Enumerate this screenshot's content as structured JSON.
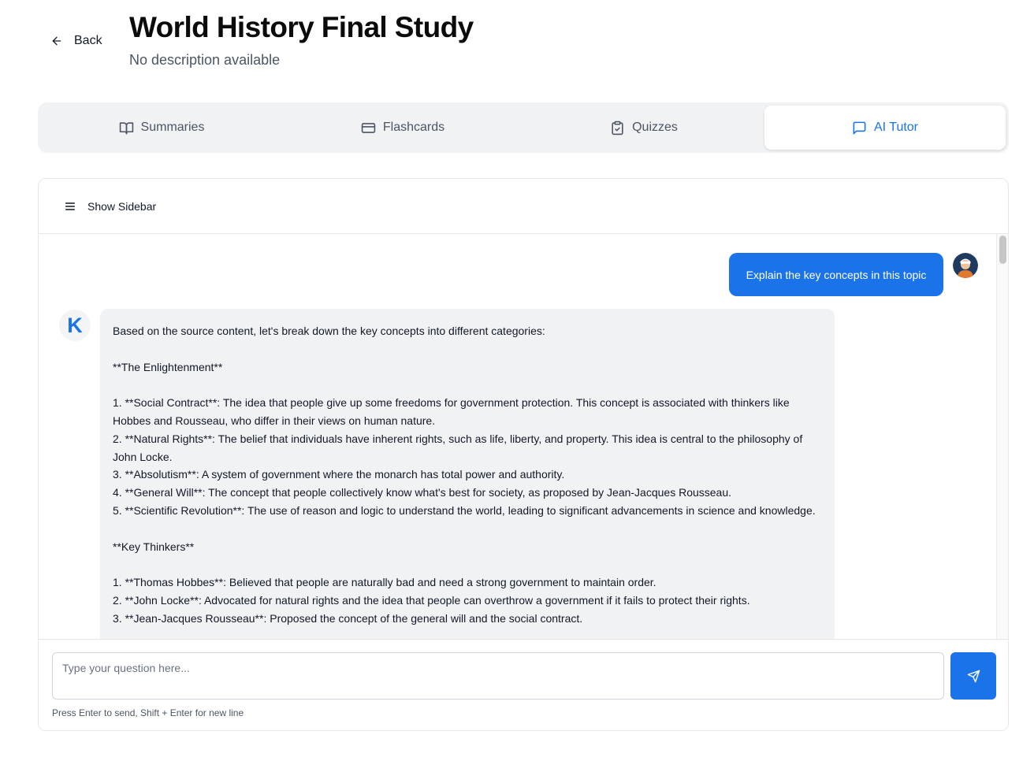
{
  "header": {
    "back_label": "Back",
    "title": "World History Final Study",
    "description": "No description available"
  },
  "tabs": [
    {
      "label": "Summaries",
      "icon": "book-open-icon",
      "active": false
    },
    {
      "label": "Flashcards",
      "icon": "credit-card-icon",
      "active": false
    },
    {
      "label": "Quizzes",
      "icon": "clipboard-check-icon",
      "active": false
    },
    {
      "label": "AI Tutor",
      "icon": "message-square-icon",
      "active": true
    }
  ],
  "chat": {
    "sidebar_toggle_label": "Show Sidebar",
    "user_message": "Explain the key concepts in this topic",
    "ai_avatar_letter": "K",
    "ai_message": "Based on the source content, let's break down the key concepts into different categories:\n\n**The Enlightenment**\n\n1. **Social Contract**: The idea that people give up some freedoms for government protection. This concept is associated with thinkers like Hobbes and Rousseau, who differ in their views on human nature.\n2. **Natural Rights**: The belief that individuals have inherent rights, such as life, liberty, and property. This idea is central to the philosophy of John Locke.\n3. **Absolutism**: A system of government where the monarch has total power and authority.\n4. **General Will**: The concept that people collectively know what's best for society, as proposed by Jean-Jacques Rousseau.\n5. **Scientific Revolution**: The use of reason and logic to understand the world, leading to significant advancements in science and knowledge.\n\n**Key Thinkers**\n\n1. **Thomas Hobbes**: Believed that people are naturally bad and need a strong government to maintain order.\n2. **John Locke**: Advocated for natural rights and the idea that people can overthrow a government if it fails to protect their rights.\n3. **Jean-Jacques Rousseau**: Proposed the concept of the general will and the social contract.",
    "input_placeholder": "Type your question here...",
    "input_value": "",
    "hint": "Press Enter to send, Shift + Enter for new line"
  },
  "colors": {
    "accent": "#1a73e8",
    "bubble_ai": "#f1f2f4",
    "tabs_bg": "#f1f2f4"
  }
}
